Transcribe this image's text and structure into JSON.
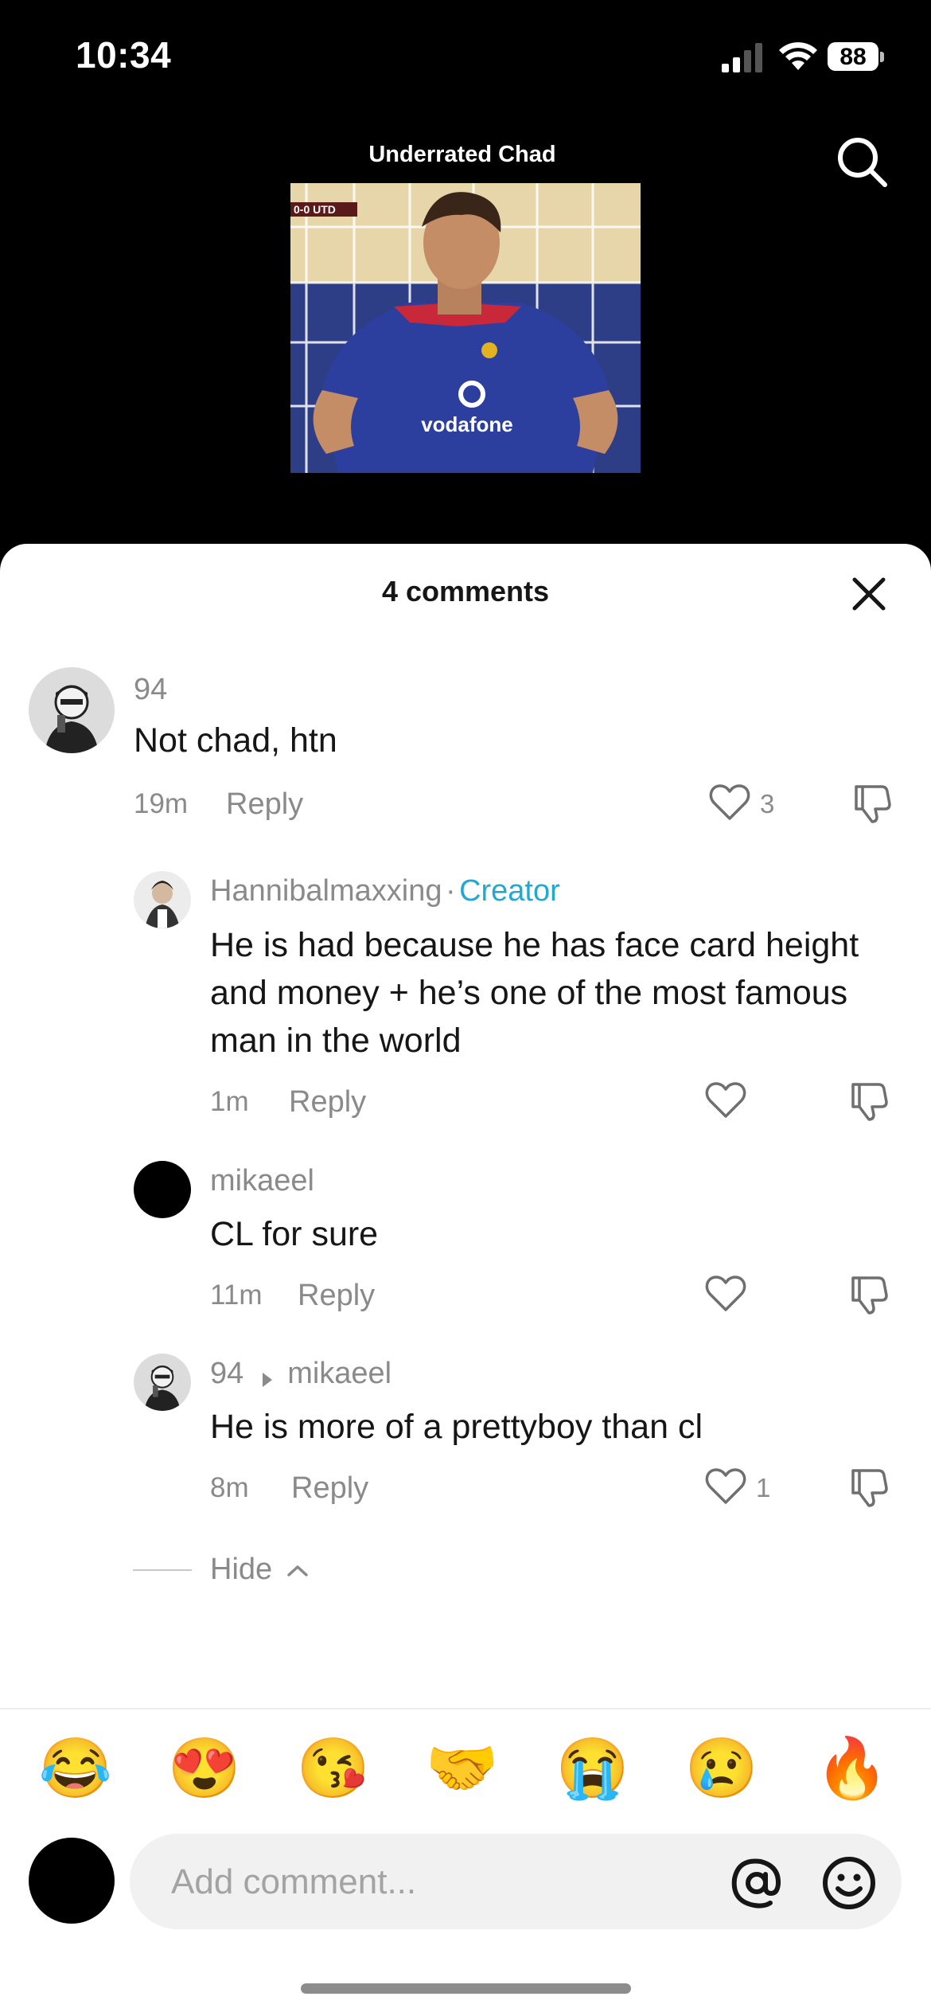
{
  "status_bar": {
    "time": "10:34",
    "battery": "88"
  },
  "video": {
    "title": "Underrated Chad",
    "scoreboard": "0-0 UTD",
    "shirt_sponsor": "vodafone"
  },
  "comments_sheet": {
    "title": "4 comments",
    "comments": [
      {
        "username": "94",
        "text": "Not chad, htn",
        "time": "19m",
        "reply": "Reply",
        "likes": "3"
      },
      {
        "username": "Hannibalmaxxing",
        "badge": "Creator",
        "separator": "·",
        "text": "He is had because he has face card height and money + he’s one of the most famous man in the world",
        "time": "1m",
        "reply": "Reply"
      },
      {
        "username": "mikaeel",
        "text": "CL for sure",
        "time": "11m",
        "reply": "Reply"
      },
      {
        "username": "94",
        "reply_to": "mikaeel",
        "text": "He is more of a prettyboy than cl",
        "time": "8m",
        "reply": "Reply",
        "likes": "1"
      }
    ],
    "hide_label": "Hide"
  },
  "quick_emojis": [
    "😂",
    "😍",
    "😘",
    "🤝",
    "😭",
    "😢",
    "🔥"
  ],
  "composer": {
    "placeholder": "Add comment..."
  },
  "icons": [
    "signal-icon",
    "wifi-icon",
    "battery-icon",
    "search-icon",
    "close-icon",
    "heart-icon",
    "dislike-icon",
    "chevron-up-icon",
    "caret-right-icon",
    "at-icon",
    "smile-icon"
  ]
}
